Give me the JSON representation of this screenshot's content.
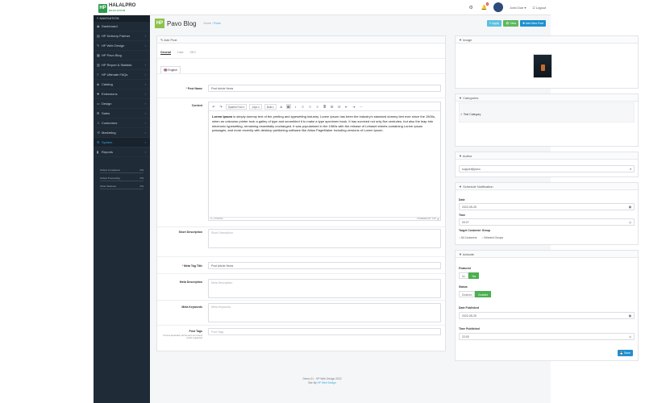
{
  "brand": {
    "mark": "HP",
    "name": "HALALPRO",
    "tagline": "EDUCATION"
  },
  "topbar": {
    "badge_count": "3",
    "user_name": "John Doe ▾",
    "logout_label": "Logout"
  },
  "nav": {
    "header": "≡ NAVIGATION",
    "items": [
      {
        "label": "Dashboard",
        "icon": "dashboard-icon",
        "glyph": "◉",
        "chev": ""
      },
      {
        "label": "HP Delivery Partner",
        "icon": "truck-icon",
        "glyph": "▤",
        "chev": "›"
      },
      {
        "label": "HP Web Design",
        "icon": "pencil-icon",
        "glyph": "✎",
        "chev": "›"
      },
      {
        "label": "HP Pavo Blog",
        "icon": "blog-icon",
        "glyph": "▦",
        "chev": ""
      },
      {
        "label": "HP Report & Statistic",
        "icon": "chart-icon",
        "glyph": "▥",
        "chev": "›"
      },
      {
        "label": "HP Ultimate FAQs",
        "icon": "question-icon",
        "glyph": "?",
        "chev": "›"
      },
      {
        "label": "Catalog",
        "icon": "tag-icon",
        "glyph": "◈",
        "chev": "›"
      },
      {
        "label": "Extensions",
        "icon": "puzzle-icon",
        "glyph": "✚",
        "chev": "›"
      },
      {
        "label": "Design",
        "icon": "monitor-icon",
        "glyph": "▭",
        "chev": "›"
      },
      {
        "label": "Sales",
        "icon": "cart-icon",
        "glyph": "⊞",
        "chev": "›"
      },
      {
        "label": "Customers",
        "icon": "user-icon",
        "glyph": "☺",
        "chev": "›"
      },
      {
        "label": "Marketing",
        "icon": "share-icon",
        "glyph": "⋲",
        "chev": "›"
      },
      {
        "label": "System",
        "icon": "gear-icon",
        "glyph": "⚙",
        "chev": "›",
        "active": true
      },
      {
        "label": "Reports",
        "icon": "report-icon",
        "glyph": "▮",
        "chev": "›"
      }
    ]
  },
  "stats": [
    {
      "label": "Orders Completed",
      "pct": "0%",
      "value": 0
    },
    {
      "label": "Orders Processing",
      "pct": "0%",
      "value": 0
    },
    {
      "label": "Other Statuses",
      "pct": "0%",
      "value": 0
    }
  ],
  "header": {
    "mark": "HP",
    "title": "Pavo Blog",
    "crumb_home": "Home",
    "crumb_current": "Posts"
  },
  "actions": {
    "apply": "✎ Apply",
    "view": "👁 View",
    "add": "✚ Add New Post"
  },
  "form": {
    "panel_title": "✎ Add Post",
    "tabs": [
      "General",
      "Data",
      "SEO"
    ],
    "lang_tab": "🇬🇧 English",
    "post_name_label": "Post Name",
    "post_name_value": "Post Article News",
    "content_label": "Content",
    "toolbar": {
      "font": "System Font ▾",
      "size": "14px ▾",
      "weight": "Bold ▾"
    },
    "content_bold": "Lorem Ipsum",
    "content_text": " is simply dummy text of the printing and typesetting industry. Lorem Ipsum has been the industry's standard dummy text ever since the 1500s, when an unknown printer took a galley of type and scrambled it to make a type specimen book. It has survived not only five centuries, but also the leap into electronic typesetting, remaining essentially unchanged. It was popularised in the 1960s with the release of Letraset sheets containing Lorem Ipsum passages, and more recently with desktop publishing software like Aldus PageMaker including versions of Lorem Ipsum.",
    "editor_path": "P » STRONG",
    "editor_brand": "POWERED BY TINY ◢",
    "short_desc_label": "Short Description",
    "short_desc_placeholder": "Short Description",
    "meta_title_label": "Meta Tag Title",
    "meta_title_value": "Post Article News",
    "meta_desc_label": "Meta Description",
    "meta_desc_placeholder": "Meta Description",
    "meta_kw_label": "Meta Keywords",
    "meta_kw_placeholder": "Meta Keywords",
    "tags_label": "Post Tags",
    "tags_hint": "Comma separated, will be seen as content words suggested",
    "tags_placeholder": "Post Tags"
  },
  "image_panel": {
    "title": "▼ Image"
  },
  "categories_panel": {
    "title": "▼ Categories",
    "item": "✓ Test Category"
  },
  "author_panel": {
    "title": "▼ Author",
    "value": "support@pavo"
  },
  "schedule_panel": {
    "title": "▼ Schedule Notification",
    "date_label": "Date",
    "date_value": "2022-05-25",
    "time_label": "Time",
    "time_value": "09:27",
    "group_label": "Target Customer Group",
    "opt_all": "○ All Customers",
    "opt_sel": "○ Selected Groups"
  },
  "activate_panel": {
    "title": "▼ Activate",
    "featured_label": "Featured",
    "featured_no": "No",
    "featured_yes": "Yes",
    "status_label": "Status",
    "status_off": "Disabled",
    "status_on": "Enabled",
    "date_pub_label": "Date Published",
    "date_pub_value": "2022-05-25",
    "time_pub_label": "Time Published",
    "time_pub_value": "22:00",
    "save": "💾 Save"
  },
  "footer": {
    "line1": "Demo-01 - HP Web Design 2022",
    "line2_prefix": "Site By ",
    "line2_link": "HP Web Design"
  }
}
